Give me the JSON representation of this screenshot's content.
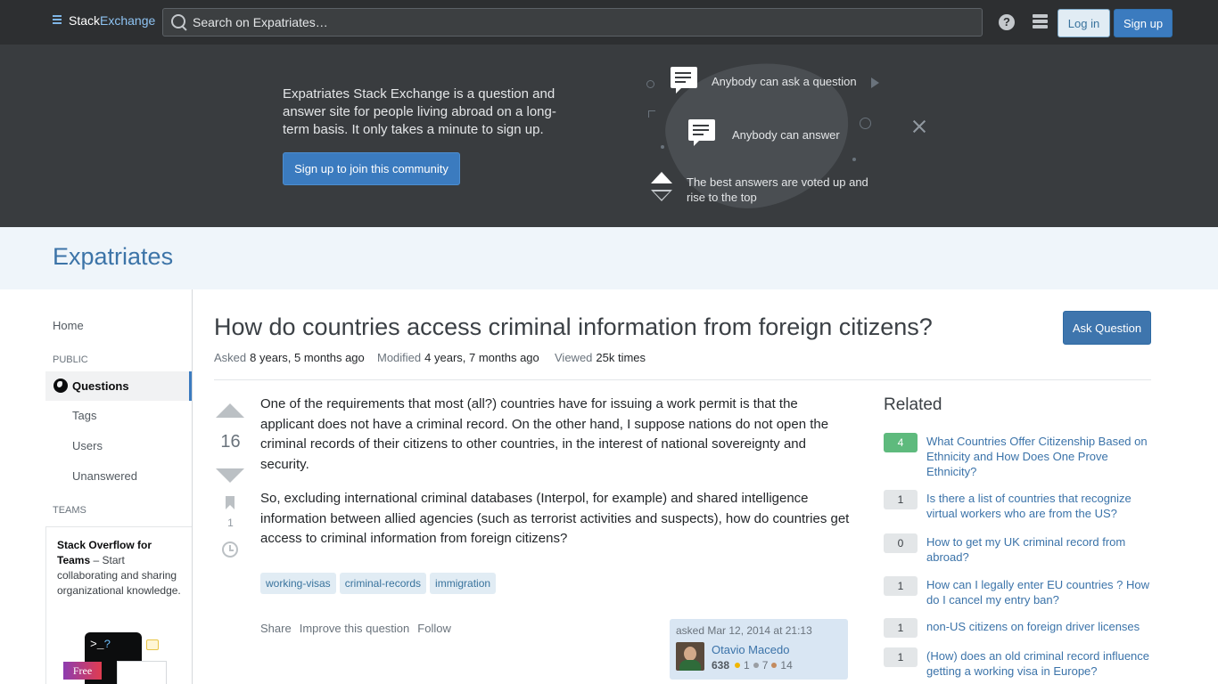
{
  "topbar": {
    "logo_stack": "Stack",
    "logo_exchange": "Exchange",
    "search_placeholder": "Search on Expatriates…",
    "help_label": "?",
    "login_label": "Log in",
    "signup_label": "Sign up"
  },
  "hero": {
    "description": "Expatriates Stack Exchange is a question and answer site for people living abroad on a long-term basis. It only takes a minute to sign up.",
    "cta_label": "Sign up to join this community",
    "features": [
      "Anybody can ask a question",
      "Anybody can answer",
      "The best answers are voted up and rise to the top"
    ]
  },
  "site": {
    "name": "Expatriates"
  },
  "leftnav": {
    "home": "Home",
    "public_label": "PUBLIC",
    "questions": "Questions",
    "tags": "Tags",
    "users": "Users",
    "unanswered": "Unanswered",
    "teams_label": "TEAMS",
    "teams_promo_title": "Stack Overflow for Teams",
    "teams_promo_text": " – Start collaborating and sharing organizational knowledge.",
    "teams_free_badge": "Free",
    "teams_terminal": ">_",
    "teams_terminal_q": "?"
  },
  "question": {
    "title": "How do countries access criminal information from foreign citizens?",
    "ask_button": "Ask Question",
    "asked_label": "Asked",
    "asked_value": "8 years, 5 months ago",
    "modified_label": "Modified",
    "modified_value": "4 years, 7 months ago",
    "viewed_label": "Viewed",
    "viewed_value": "25k times",
    "votes": "16",
    "bookmarks": "1",
    "body": [
      "One of the requirements that most (all?) countries have for issuing a work permit is that the applicant does not have a criminal record. On the other hand, I suppose nations do not open the criminal records of their citizens to other countries, in the interest of national sovereignty and security.",
      "So, excluding international criminal databases (Interpol, for example) and shared intelligence information between allied agencies (such as terrorist activities and suspects), how do countries get access to criminal information from foreign citizens?"
    ],
    "tags": [
      "working-visas",
      "criminal-records",
      "immigration"
    ],
    "menu": {
      "share": "Share",
      "improve": "Improve this question",
      "follow": "Follow"
    },
    "author": {
      "asked_text": "asked Mar 12, 2014 at 21:13",
      "name": "Otavio Macedo",
      "reputation": "638",
      "gold": "1",
      "silver": "7",
      "bronze": "14"
    }
  },
  "related": {
    "title": "Related",
    "items": [
      {
        "score": "4",
        "hot": true,
        "text": "What Countries Offer Citizenship Based on Ethnicity and How Does One Prove Ethnicity?"
      },
      {
        "score": "1",
        "hot": false,
        "text": "Is there a list of countries that recognize virtual workers who are from the US?"
      },
      {
        "score": "0",
        "hot": false,
        "text": "How to get my UK criminal record from abroad?"
      },
      {
        "score": "1",
        "hot": false,
        "text": "How can I legally enter EU countries ? How do I cancel my entry ban?"
      },
      {
        "score": "1",
        "hot": false,
        "text": "non-US citizens on foreign driver licenses"
      },
      {
        "score": "1",
        "hot": false,
        "text": "(How) does an old criminal record influence getting a working visa in Europe?"
      }
    ]
  },
  "colors": {
    "topbar_bg": "#2d2f31",
    "hero_bg": "#393c3f",
    "accent_blue": "#3b7bbf",
    "hot_green": "#5eba7d"
  }
}
